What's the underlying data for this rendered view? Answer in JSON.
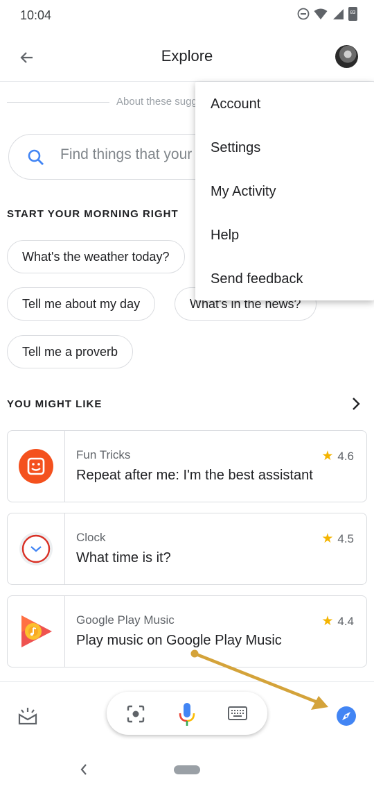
{
  "status_bar": {
    "time": "10:04",
    "battery": "83"
  },
  "app_bar": {
    "title": "Explore"
  },
  "about": {
    "text": "About these suggestions"
  },
  "search": {
    "placeholder": "Find things that your Assistant can do"
  },
  "morning": {
    "title": "START YOUR MORNING RIGHT",
    "chips": [
      "What's the weather today?",
      "Tell me about my day",
      "What's in the news?",
      "Tell me a proverb"
    ]
  },
  "recommend": {
    "title": "YOU MIGHT LIKE",
    "cards": [
      {
        "category": "Fun Tricks",
        "title": "Repeat after me: I'm the best assistant",
        "rating": "4.6",
        "icon": "fun-tricks-icon",
        "color": "#f4511e"
      },
      {
        "category": "Clock",
        "title": "What time is it?",
        "rating": "4.5",
        "icon": "clock-icon",
        "color": "#d93025"
      },
      {
        "category": "Google Play Music",
        "title": "Play music on Google Play Music",
        "rating": "4.4",
        "icon": "play-music-icon",
        "color": "#ff5722"
      }
    ]
  },
  "menu": {
    "items": [
      "Account",
      "Settings",
      "My Activity",
      "Help",
      "Send feedback"
    ]
  },
  "bottom_bar": {
    "icons": [
      "updates-icon",
      "lens-icon",
      "mic-icon",
      "keyboard-icon",
      "explore-icon"
    ]
  },
  "colors": {
    "accent_blue": "#4285f4",
    "annotation": "#d4a33a",
    "star": "#f4b400"
  }
}
